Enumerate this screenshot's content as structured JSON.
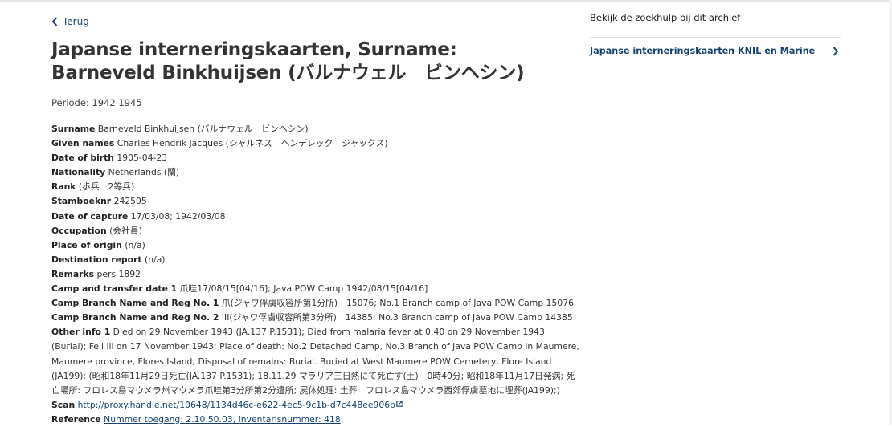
{
  "nav": {
    "back_label": "Terug"
  },
  "title": "Japanse interneringskaarten, Surname: Barneveld Binkhuijsen (バルナウェル　ビンヘシン)",
  "periode": "Periode: 1942 1945",
  "fields": [
    {
      "label": "Surname",
      "value": "Barneveld Binkhuijsen (バルナウェル　ビンヘシン)"
    },
    {
      "label": "Given names",
      "value": "Charles Hendrik Jacques (シャルネス　ヘンデレック　ジャックス)"
    },
    {
      "label": "Date of birth",
      "value": "1905-04-23"
    },
    {
      "label": "Nationality",
      "value": "Netherlands (蘭)"
    },
    {
      "label": "Rank",
      "value": "(歩兵　2等兵)"
    },
    {
      "label": "Stamboeknr",
      "value": "242505"
    },
    {
      "label": "Date of capture",
      "value": "17/03/08; 1942/03/08"
    },
    {
      "label": "Occupation",
      "value": "(会社員)"
    },
    {
      "label": "Place of origin",
      "value": "(n/a)"
    },
    {
      "label": "Destination report",
      "value": "(n/a)"
    },
    {
      "label": "Remarks",
      "value": "pers 1892"
    },
    {
      "label": "Camp and transfer date 1",
      "value": "爪哇17/08/15[04/16]; Java POW Camp 1942/08/15[04/16]"
    },
    {
      "label": "Camp Branch Name and Reg No. 1",
      "value": "爪(ジャワ俘虜収容所第1分所)　15076; No.1 Branch camp of Java POW Camp 15076"
    },
    {
      "label": "Camp Branch Name and Reg No. 2",
      "value": "III(ジャワ俘虜収容所第3分所)　14385; No.3 Branch camp of Java POW Camp 14385"
    },
    {
      "label": "Other info 1",
      "value": "Died on 29 November 1943 (JA.137 P.1531); Died from malaria fever at 0:40 on 29 November 1943 (Burial); Fell ill on 17 November 1943; Place of death: No.2 Detached Camp, No.3 Branch of Java POW Camp in Maumere, Maumere province, Flores Island; Disposal of remains: Burial. Buried at West Maumere POW Cemetery, Flore Island (JA199); (昭和18年11月29日死亡(JA.137 P.1531); 18.11.29 マラリア三日熱にて死亡す(土)　0時40分; 昭和18年11月17日発病; 死亡場所: フロレス島マウメラ州マウメラ爪哇第3分所第2分遣所; 屍体処理: 土葬　フロレス島マウメラ西郊俘虜墓地に埋葬(JA199);)"
    }
  ],
  "scan": {
    "label": "Scan",
    "url": "http://proxy.handle.net/10648/1134d46c-e622-4ec5-9c1b-d7c448ee906b"
  },
  "reference": {
    "label": "Reference",
    "value": "Nummer toegang: 2.10.50.03, Inventarisnummer: 418"
  },
  "sidebar": {
    "heading": "Bekijk de zoekhulp bij dit archief",
    "link_label": "Japanse interneringskaarten KNIL en Marine"
  },
  "colors": {
    "link": "#154273",
    "text": "#333333"
  }
}
